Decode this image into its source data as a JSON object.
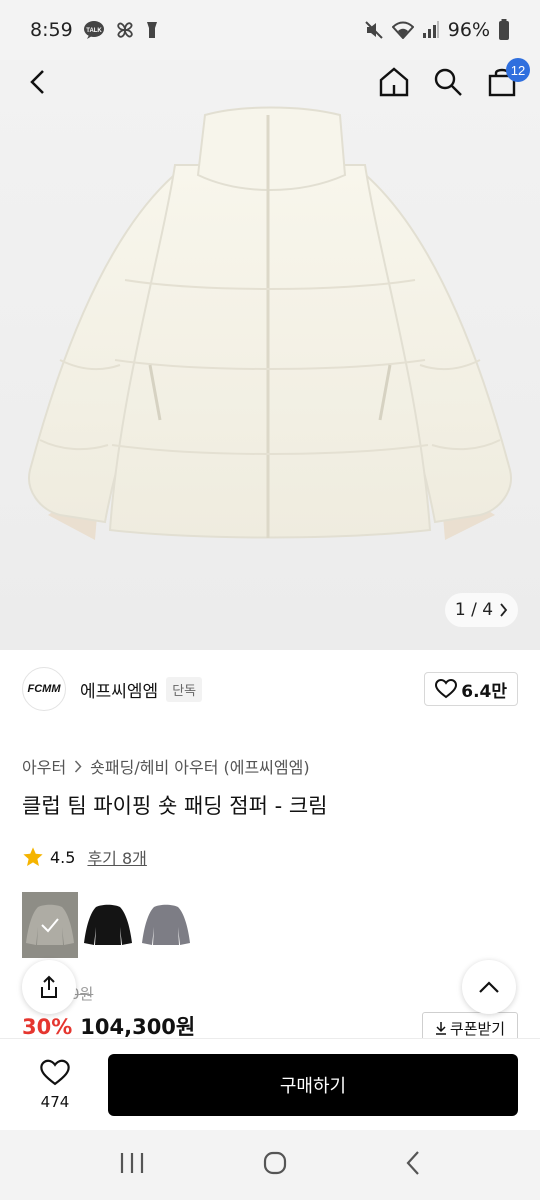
{
  "status_bar": {
    "time": "8:59",
    "notifications": [
      "kakaotalk-icon",
      "pinwheel-icon",
      "flashlight-icon"
    ],
    "battery": "96%"
  },
  "header": {
    "cart_count": "12"
  },
  "gallery": {
    "counter": "1 / 4"
  },
  "brand": {
    "logo_text": "FCMM",
    "name": "에프씨엠엠",
    "tag": "단독",
    "likes": "6.4만"
  },
  "product": {
    "breadcrumb": [
      "아우터",
      "숏패딩/헤비 아우터 (에프씨엠엠)"
    ],
    "title": "클럽 팀 파이핑 숏 패딩 점퍼 - 크림",
    "rating": "4.5",
    "reviews": "후기 8개",
    "swatches": [
      {
        "color": "#efece1",
        "selected": true
      },
      {
        "color": "#141414",
        "selected": false
      },
      {
        "color": "#7d7d85",
        "selected": false
      }
    ],
    "original_price_visible": "0원",
    "discount": "30%",
    "price": "104,300원",
    "coupon_label": "쿠폰받기"
  },
  "bottom_bar": {
    "wish_count": "474",
    "buy_label": "구매하기"
  },
  "colors": {
    "accent_blue": "#2f6fde",
    "discount_red": "#e5362f"
  }
}
